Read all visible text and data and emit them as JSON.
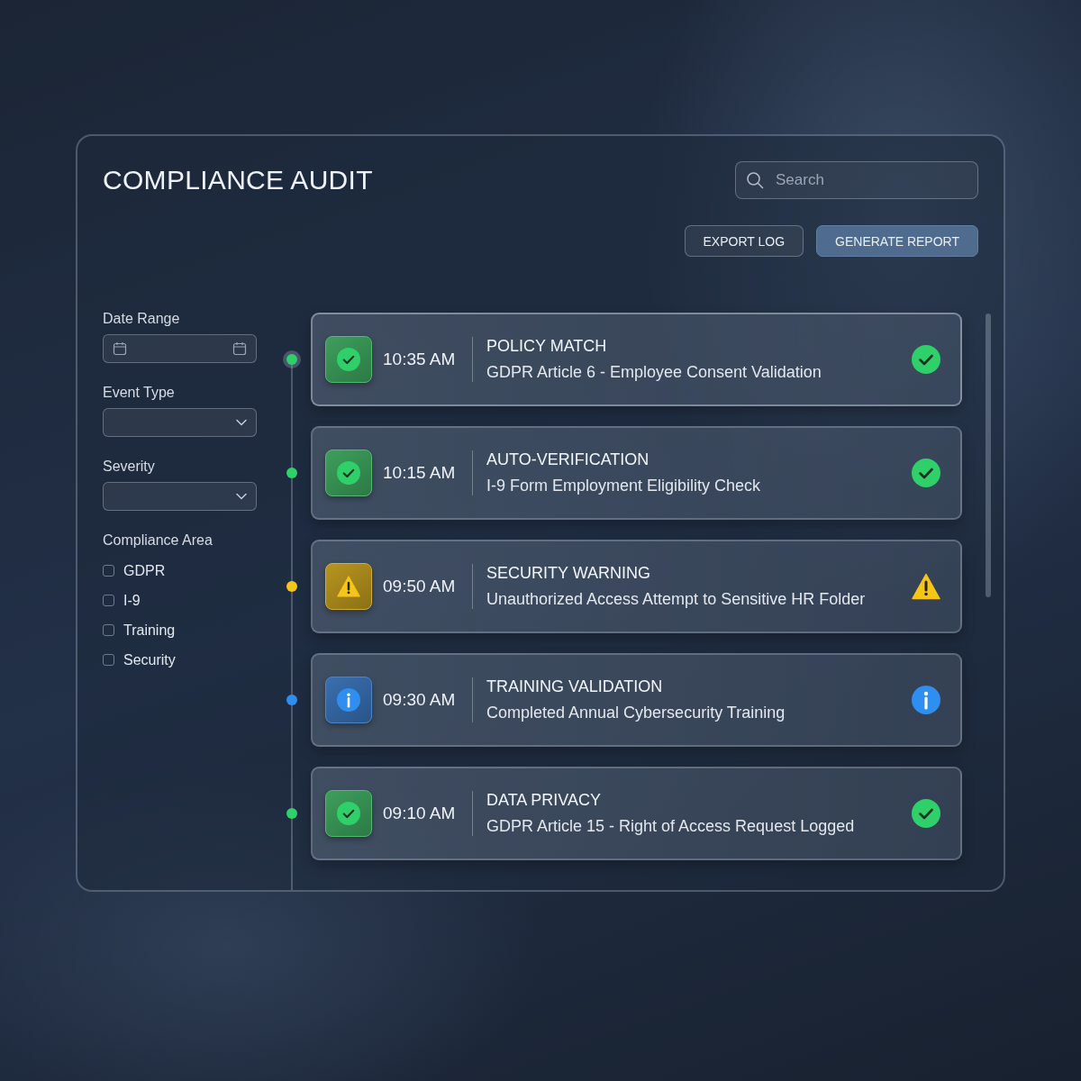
{
  "title": "COMPLIANCE AUDIT",
  "search": {
    "placeholder": "Search"
  },
  "buttons": [
    {
      "label": "EXPORT LOG",
      "kind": "secondary"
    },
    {
      "label": "GENERATE REPORT",
      "kind": "primary"
    }
  ],
  "filters": {
    "date_range": {
      "label": "Date Range"
    },
    "selects": [
      {
        "label": "Event Type"
      },
      {
        "label": "Severity"
      }
    ],
    "compliance_area": {
      "label": "Compliance Area",
      "options": [
        {
          "label": "GDPR",
          "checked": false
        },
        {
          "label": "I-9",
          "checked": false
        },
        {
          "label": "Training",
          "checked": false
        },
        {
          "label": "Security",
          "checked": false
        }
      ]
    }
  },
  "events": [
    {
      "kind": "success",
      "time": "10:35 AM",
      "title": "POLICY MATCH",
      "description": "GDPR Article 6 - Employee Consent Validation",
      "selected": true
    },
    {
      "kind": "success",
      "time": "10:15 AM",
      "title": "AUTO-VERIFICATION",
      "description": "I-9 Form Employment Eligibility Check",
      "selected": false
    },
    {
      "kind": "warning",
      "time": "09:50 AM",
      "title": "SECURITY WARNING",
      "description": "Unauthorized Access Attempt to Sensitive HR Folder",
      "selected": false
    },
    {
      "kind": "info",
      "time": "09:30 AM",
      "title": "TRAINING VALIDATION",
      "description": "Completed Annual Cybersecurity Training",
      "selected": false
    },
    {
      "kind": "success",
      "time": "09:10 AM",
      "title": "DATA PRIVACY",
      "description": "GDPR Article 15 - Right of Access Request Logged",
      "selected": false
    }
  ]
}
